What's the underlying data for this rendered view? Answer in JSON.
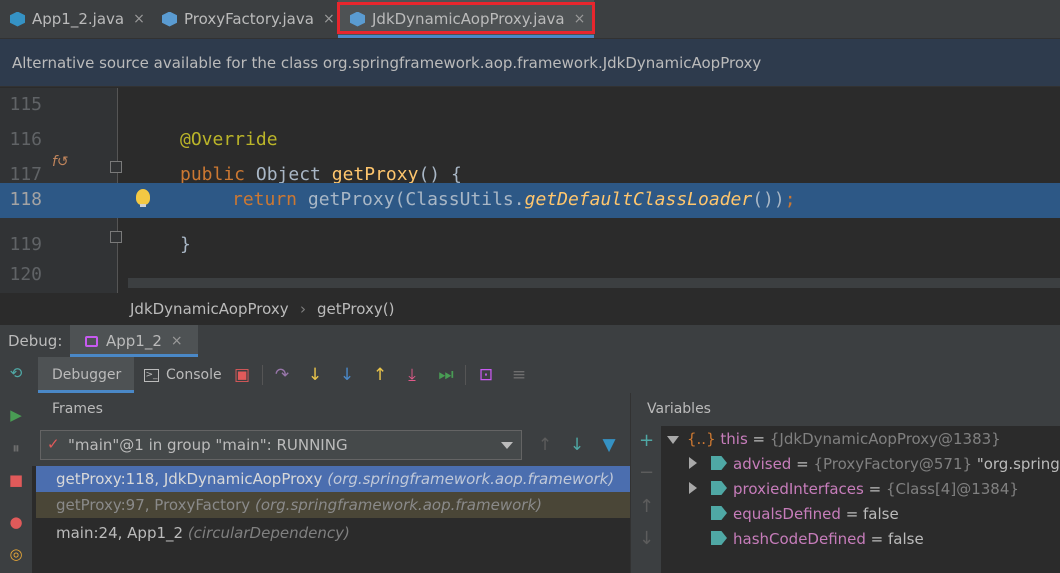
{
  "editor_tabs": [
    {
      "label": "App1_2.java"
    },
    {
      "label": "ProxyFactory.java"
    },
    {
      "label": "JdkDynamicAopProxy.java"
    }
  ],
  "close_glyph": "×",
  "notification": "Alternative source available for the class org.springframework.aop.framework.JdkDynamicAopProxy",
  "code_lines": [
    {
      "number": "115",
      "parts": []
    },
    {
      "number": "116",
      "parts": [
        "@Override"
      ]
    },
    {
      "number": "117",
      "parts": [
        "public",
        " Object ",
        "getProxy",
        "() {"
      ]
    },
    {
      "number": "118",
      "parts": [
        "return",
        " getProxy(ClassUtils.",
        "getDefaultClassLoader",
        "())",
        ";"
      ]
    },
    {
      "number": "119",
      "parts": [
        "}"
      ]
    },
    {
      "number": "120",
      "parts": []
    }
  ],
  "override_glyph": "f↺",
  "breadcrumbs": [
    "JdkDynamicAopProxy",
    "getProxy()"
  ],
  "breadcrumb_sep": "›",
  "debug": {
    "label": "Debug:",
    "session": "App1_2",
    "tab_debugger": "Debugger",
    "tab_console": "Console",
    "frames_title": "Frames",
    "variables_title": "Variables",
    "thread": "\"main\"@1 in group \"main\": RUNNING",
    "thread_check": "✓",
    "frames": [
      {
        "method": "getProxy:118, JdkDynamicAopProxy ",
        "pkg": "(org.springframework.aop.framework)"
      },
      {
        "method": "getProxy:97, ProxyFactory ",
        "pkg": "(org.springframework.aop.framework)"
      },
      {
        "method": "main:24, App1_2 ",
        "pkg": "(circularDependency)"
      }
    ],
    "variables": [
      {
        "prefix": "{..}",
        "name": "this",
        "eq": " = ",
        "value": "{JdkDynamicAopProxy@1383}",
        "extra": ""
      },
      {
        "prefix": "",
        "name": "advised",
        "eq": " = ",
        "value": "{ProxyFactory@571}",
        "extra": " \"org.springfra"
      },
      {
        "prefix": "",
        "name": "proxiedInterfaces",
        "eq": " = ",
        "value": "{Class[4]@1384}",
        "extra": ""
      },
      {
        "prefix": "",
        "name": "equalsDefined",
        "eq": " = ",
        "value": "false",
        "extra": ""
      },
      {
        "prefix": "",
        "name": "hashCodeDefined",
        "eq": " = ",
        "value": "false",
        "extra": ""
      }
    ]
  },
  "icons": {
    "rerun": "⟲",
    "resume": "▶",
    "pause": "⏸",
    "stop": "■",
    "breakpoints": "●",
    "mute": "◎",
    "restore_layout": "▣",
    "step_over": "↷",
    "step_into": "↓",
    "force_step_into": "↓",
    "step_out": "↑",
    "drop_frame": "⤓",
    "run_to_cursor": "⏭",
    "evaluate": "⊡",
    "trace": "≡",
    "frame_up": "↑",
    "frame_down": "↓",
    "filter": "▼",
    "add_watch": "+",
    "remove_watch": "−",
    "move_up": "↑",
    "move_down": "↓"
  },
  "colors": {
    "accent": "#4a88c7",
    "highlight_border": "#e8262d",
    "current_line": "#2d5886",
    "selected_frame": "#4b6eaf"
  }
}
